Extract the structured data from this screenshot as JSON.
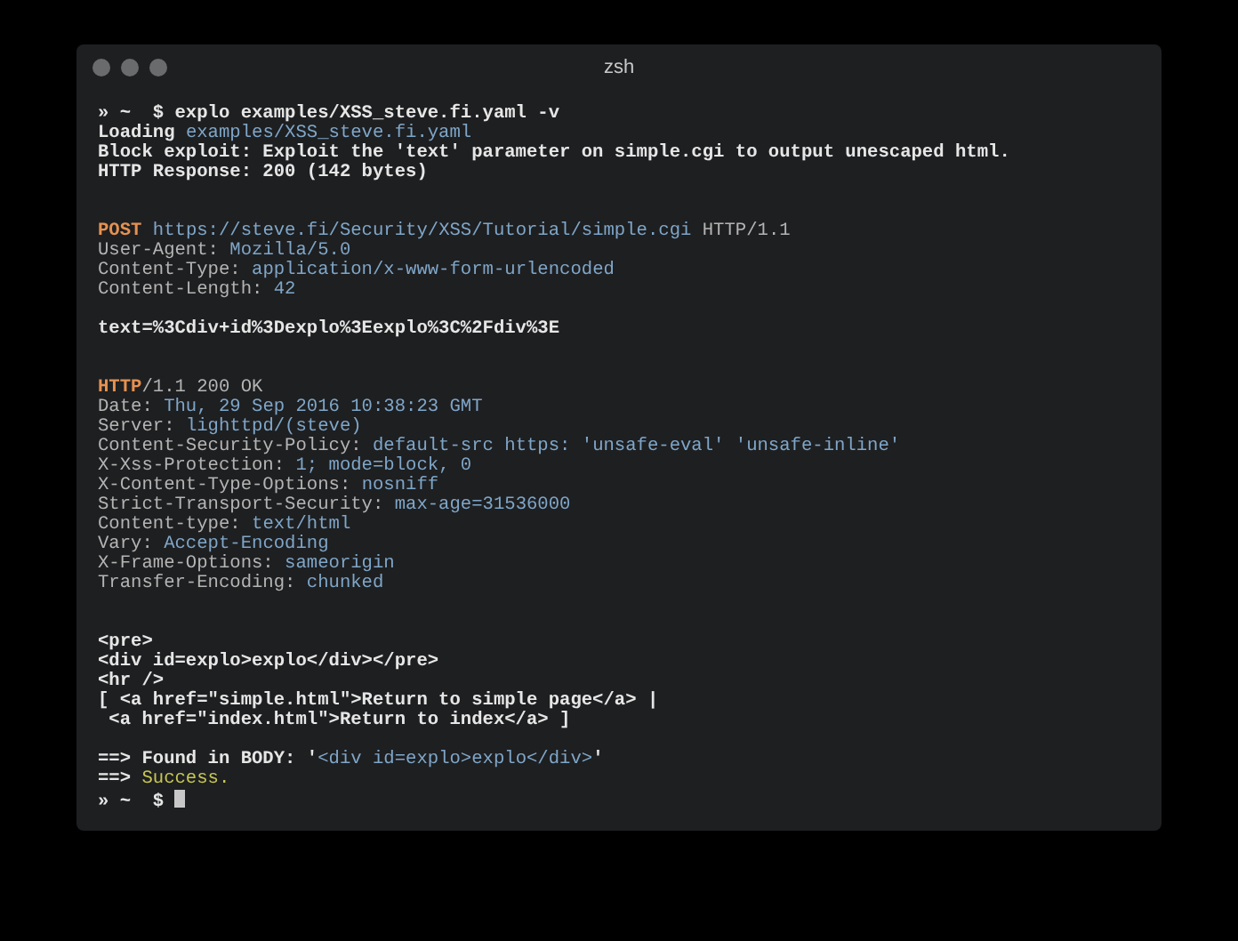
{
  "window": {
    "title": "zsh"
  },
  "lines": [
    {
      "kind": "text",
      "segments": [
        {
          "kind": "strong",
          "text": "» ~  $ explo examples/XSS_steve.fi.yaml -v"
        }
      ]
    },
    {
      "kind": "text",
      "segments": [
        {
          "kind": "strong",
          "text": "Loading "
        },
        {
          "kind": "value",
          "text": "examples/XSS_steve.fi.yaml"
        }
      ]
    },
    {
      "kind": "text",
      "segments": [
        {
          "kind": "strong",
          "text": "Block exploit: Exploit the 'text' parameter on simple.cgi to output unescaped html."
        }
      ]
    },
    {
      "kind": "text",
      "segments": [
        {
          "kind": "strong",
          "text": "HTTP Response: 200 (142 bytes)"
        }
      ]
    },
    {
      "kind": "blank"
    },
    {
      "kind": "blank"
    },
    {
      "kind": "text",
      "segments": [
        {
          "kind": "method",
          "text": "POST "
        },
        {
          "kind": "value",
          "text": "https://steve.fi/Security/XSS/Tutorial/simple.cgi"
        },
        {
          "kind": "key",
          "text": " HTTP/1.1"
        }
      ]
    },
    {
      "kind": "text",
      "segments": [
        {
          "kind": "key",
          "text": "User-Agent: "
        },
        {
          "kind": "value",
          "text": "Mozilla/5.0"
        }
      ]
    },
    {
      "kind": "text",
      "segments": [
        {
          "kind": "key",
          "text": "Content-Type: "
        },
        {
          "kind": "value",
          "text": "application/x-www-form-urlencoded"
        }
      ]
    },
    {
      "kind": "text",
      "segments": [
        {
          "kind": "key",
          "text": "Content-Length: "
        },
        {
          "kind": "value",
          "text": "42"
        }
      ]
    },
    {
      "kind": "blank"
    },
    {
      "kind": "text",
      "segments": [
        {
          "kind": "strong",
          "text": "text=%3Cdiv+id%3Dexplo%3Eexplo%3C%2Fdiv%3E"
        }
      ]
    },
    {
      "kind": "blank"
    },
    {
      "kind": "blank"
    },
    {
      "kind": "text",
      "segments": [
        {
          "kind": "method",
          "text": "HTTP"
        },
        {
          "kind": "key",
          "text": "/1.1 200 OK"
        }
      ]
    },
    {
      "kind": "text",
      "segments": [
        {
          "kind": "key",
          "text": "Date: "
        },
        {
          "kind": "value",
          "text": "Thu, 29 Sep 2016 10:38:23 GMT"
        }
      ]
    },
    {
      "kind": "text",
      "segments": [
        {
          "kind": "key",
          "text": "Server: "
        },
        {
          "kind": "value",
          "text": "lighttpd/(steve)"
        }
      ]
    },
    {
      "kind": "text",
      "segments": [
        {
          "kind": "key",
          "text": "Content-Security-Policy: "
        },
        {
          "kind": "value",
          "text": "default-src https: 'unsafe-eval' 'unsafe-inline'"
        }
      ]
    },
    {
      "kind": "text",
      "segments": [
        {
          "kind": "key",
          "text": "X-Xss-Protection: "
        },
        {
          "kind": "value",
          "text": "1; mode=block, 0"
        }
      ]
    },
    {
      "kind": "text",
      "segments": [
        {
          "kind": "key",
          "text": "X-Content-Type-Options: "
        },
        {
          "kind": "value",
          "text": "nosniff"
        }
      ]
    },
    {
      "kind": "text",
      "segments": [
        {
          "kind": "key",
          "text": "Strict-Transport-Security: "
        },
        {
          "kind": "value",
          "text": "max-age=31536000"
        }
      ]
    },
    {
      "kind": "text",
      "segments": [
        {
          "kind": "key",
          "text": "Content-type: "
        },
        {
          "kind": "value",
          "text": "text/html"
        }
      ]
    },
    {
      "kind": "text",
      "segments": [
        {
          "kind": "key",
          "text": "Vary: "
        },
        {
          "kind": "value",
          "text": "Accept-Encoding"
        }
      ]
    },
    {
      "kind": "text",
      "segments": [
        {
          "kind": "key",
          "text": "X-Frame-Options: "
        },
        {
          "kind": "value",
          "text": "sameorigin"
        }
      ]
    },
    {
      "kind": "text",
      "segments": [
        {
          "kind": "key",
          "text": "Transfer-Encoding: "
        },
        {
          "kind": "value",
          "text": "chunked"
        }
      ]
    },
    {
      "kind": "blank"
    },
    {
      "kind": "blank"
    },
    {
      "kind": "text",
      "segments": [
        {
          "kind": "strong",
          "text": "<pre>"
        }
      ]
    },
    {
      "kind": "text",
      "segments": [
        {
          "kind": "strong",
          "text": "<div id=explo>explo</div></pre>"
        }
      ]
    },
    {
      "kind": "text",
      "segments": [
        {
          "kind": "strong",
          "text": "<hr />"
        }
      ]
    },
    {
      "kind": "text",
      "segments": [
        {
          "kind": "strong",
          "text": "[ <a href=\"simple.html\">Return to simple page</a> |"
        }
      ]
    },
    {
      "kind": "text",
      "segments": [
        {
          "kind": "strong",
          "text": " <a href=\"index.html\">Return to index</a> ]"
        }
      ]
    },
    {
      "kind": "blank"
    },
    {
      "kind": "text",
      "segments": [
        {
          "kind": "strong",
          "text": "==> Found in BODY: '"
        },
        {
          "kind": "value",
          "text": "<div id=explo>explo</div>"
        },
        {
          "kind": "strong",
          "text": "'"
        }
      ]
    },
    {
      "kind": "text",
      "segments": [
        {
          "kind": "strong",
          "text": "==> "
        },
        {
          "kind": "success",
          "text": "Success."
        }
      ]
    },
    {
      "kind": "text",
      "segments": [
        {
          "kind": "strong",
          "text": "» ~  $ "
        }
      ],
      "cursor": true
    }
  ]
}
